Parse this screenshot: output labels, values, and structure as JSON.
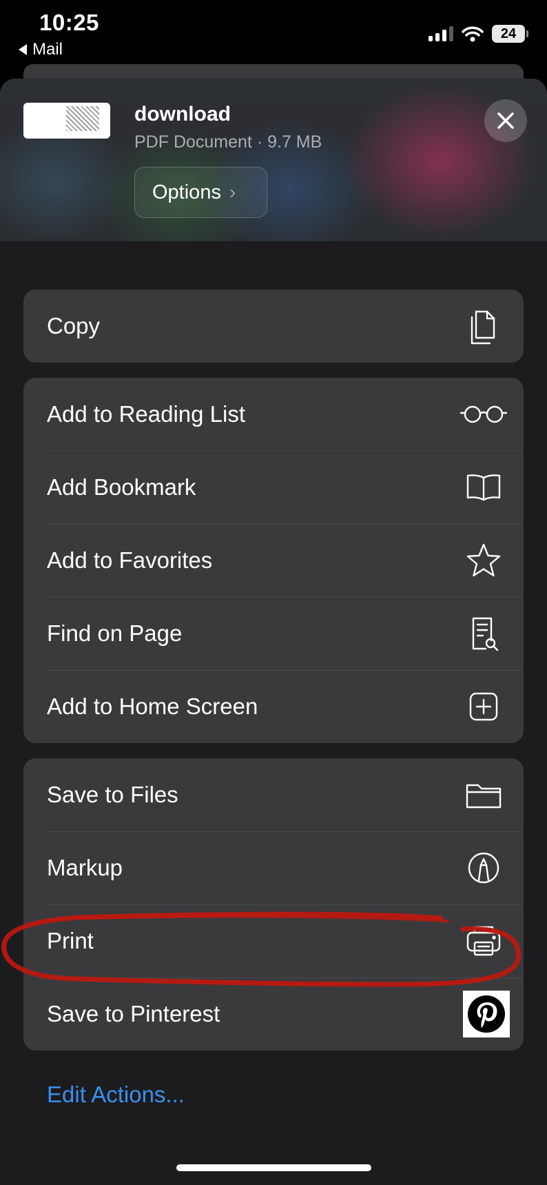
{
  "status": {
    "time": "10:25",
    "back_app": "Mail",
    "battery": "24"
  },
  "document": {
    "title": "download",
    "meta": "PDF Document · 9.7 MB",
    "options_label": "Options"
  },
  "groups": [
    {
      "items": [
        {
          "label": "Copy",
          "icon": "copy-icon"
        }
      ]
    },
    {
      "items": [
        {
          "label": "Add to Reading List",
          "icon": "glasses-icon"
        },
        {
          "label": "Add Bookmark",
          "icon": "book-icon"
        },
        {
          "label": "Add to Favorites",
          "icon": "star-icon"
        },
        {
          "label": "Find on Page",
          "icon": "find-document-icon"
        },
        {
          "label": "Add to Home Screen",
          "icon": "plus-square-icon"
        }
      ]
    },
    {
      "items": [
        {
          "label": "Save to Files",
          "icon": "folder-icon"
        },
        {
          "label": "Markup",
          "icon": "markup-pen-icon"
        },
        {
          "label": "Print",
          "icon": "printer-icon"
        },
        {
          "label": "Save to Pinterest",
          "icon": "pinterest-icon"
        }
      ]
    }
  ],
  "edit_actions_label": "Edit Actions...",
  "colors": {
    "sheet_background": "#1c1c1e",
    "row_background": "#3a3a3c",
    "link_blue": "#3b8ff0",
    "annotation_red": "#c0180f",
    "pinterest_red": "#e60023"
  }
}
